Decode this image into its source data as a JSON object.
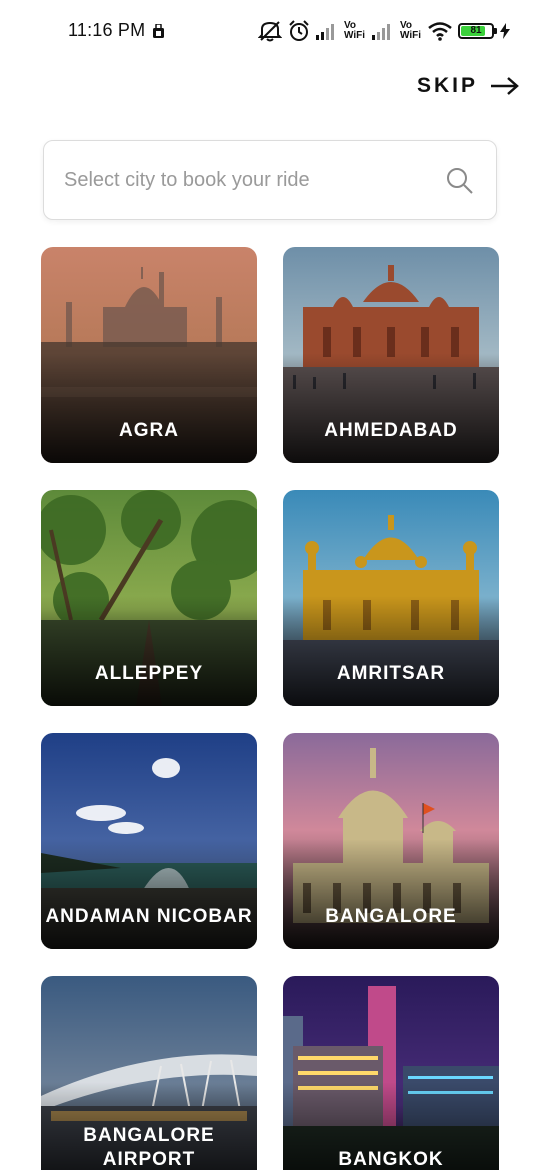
{
  "status_bar": {
    "time": "11:16 PM",
    "vo_wifi_1": "Vo WiFi",
    "vo_wifi_2": "Vo WiFi",
    "battery": "81",
    "battery_level": 0.81
  },
  "header": {
    "skip_label": "SKIP"
  },
  "search": {
    "placeholder": "Select city to book your ride"
  },
  "cities": [
    {
      "label": "AGRA",
      "image": "agra-photo"
    },
    {
      "label": "AHMEDABAD",
      "image": "ahmedabad-photo"
    },
    {
      "label": "ALLEPPEY",
      "image": "alleppey-photo"
    },
    {
      "label": "AMRITSAR",
      "image": "amritsar-photo"
    },
    {
      "label": "ANDAMAN NICOBAR",
      "image": "andaman-nicobar-photo"
    },
    {
      "label": "BANGALORE",
      "image": "bangalore-photo"
    },
    {
      "label": "BANGALORE AIRPORT",
      "image": "bangalore-airport-photo"
    },
    {
      "label": "BANGKOK",
      "image": "bangkok-photo"
    }
  ]
}
